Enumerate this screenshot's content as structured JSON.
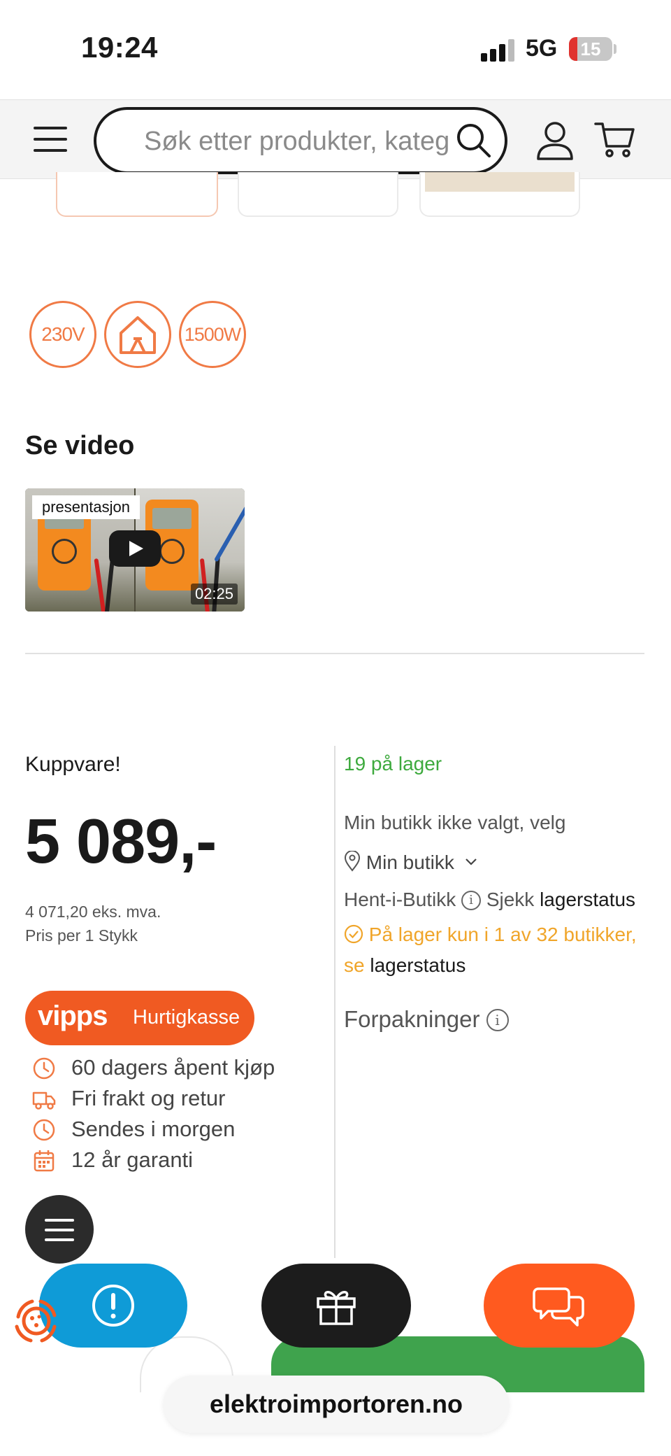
{
  "status_bar": {
    "time": "19:24",
    "network": "5G",
    "battery": "15"
  },
  "header": {
    "search_placeholder": "Søk etter produkter, kateg"
  },
  "badges": [
    "230V",
    "",
    "1500W"
  ],
  "video": {
    "heading": "Se video",
    "label": "presentasjon",
    "duration": "02:25"
  },
  "pricing": {
    "deal_label": "Kuppvare!",
    "price": "5 089,-",
    "ex_vat": "4 071,20 eks. mva.",
    "per_unit": "Pris per 1 Stykk",
    "vipps_logo": "vipps",
    "vipps_label": "Hurtigkasse"
  },
  "usps": [
    {
      "icon": "clock-icon",
      "text": "60 dagers åpent kjøp"
    },
    {
      "icon": "truck-icon",
      "text": "Fri frakt og retur"
    },
    {
      "icon": "clock-icon",
      "text": "Sendes i morgen"
    },
    {
      "icon": "calendar-icon",
      "text": "12 år garanti"
    }
  ],
  "stock": {
    "in_stock": "19 på lager",
    "store_not_selected": "Min butikk ikke valgt, velg",
    "my_store": "Min butikk",
    "pickup": "Hent-i-Butikk",
    "check": "Sjekk",
    "stock_status_link": "lagerstatus",
    "availability": "På lager kun i 1 av 32 butikker, se",
    "availability_link": "lagerstatus",
    "packaging": "Forpakninger"
  },
  "browser": {
    "url": "elektroimportoren.no"
  },
  "colors": {
    "accent": "#f07a45",
    "green": "#3eaa3e",
    "orange_warn": "#f0a52a",
    "blue": "#0f9bd7",
    "chat_orange": "#ff5a1f"
  }
}
